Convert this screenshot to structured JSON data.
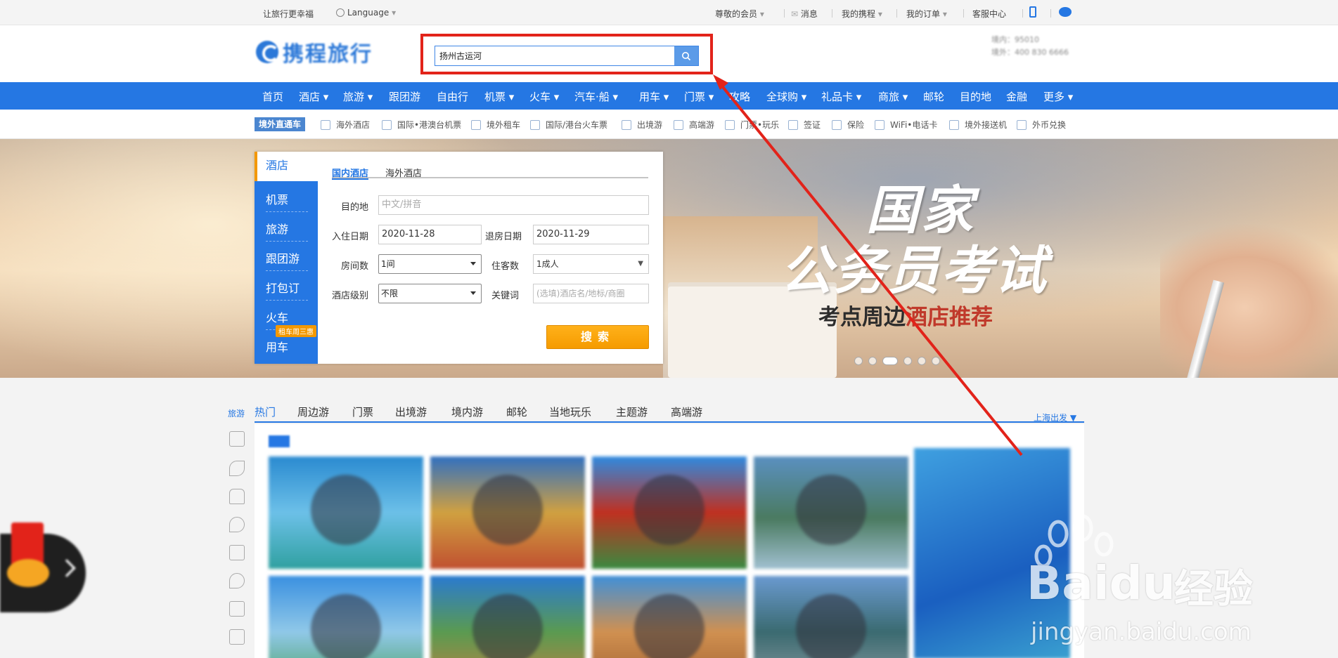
{
  "topbar": {
    "slogan": "让旅行更幸福",
    "language": "Language",
    "member": "尊敬的会员",
    "messages": "消息",
    "my_trips": "我的携程",
    "my_orders": "我的订单",
    "service": "客服中心"
  },
  "header": {
    "logo_text": "携程旅行",
    "search_value": "扬州古运河",
    "hotline_1": "境内：95010",
    "hotline_2": "境外：400 830 6666"
  },
  "nav": {
    "items": [
      "首页",
      "酒店 ▾",
      "旅游 ▾",
      "跟团游",
      "自由行",
      "机票 ▾",
      "火车 ▾",
      "汽车·船 ▾",
      "用车 ▾",
      "门票 ▾",
      "攻略",
      "全球购 ▾",
      "礼品卡 ▾",
      "商旅 ▾",
      "邮轮",
      "目的地",
      "金融",
      "更多 ▾"
    ]
  },
  "subnav": {
    "badge": "境外直通车",
    "items": [
      "海外酒店",
      "国际•港澳台机票",
      "境外租车",
      "国际/港台火车票",
      "出境游",
      "高端游",
      "门票•玩乐",
      "签证",
      "保险",
      "WiFi•电话卡",
      "境外接送机",
      "外币兑换"
    ]
  },
  "booking": {
    "side_tabs": [
      "酒店",
      "机票",
      "旅游",
      "跟团游",
      "打包订",
      "火车",
      "用车"
    ],
    "rent_badge": "租车周三惠",
    "tabs": [
      "国内酒店",
      "海外酒店"
    ],
    "dest_label": "目的地",
    "dest_placeholder": "中文/拼音",
    "checkin_label": "入住日期",
    "checkin_value": "2020-11-28",
    "checkout_label": "退房日期",
    "checkout_value": "2020-11-29",
    "rooms_label": "房间数",
    "rooms_value": "1间",
    "guests_label": "住客数",
    "guests_value": "1成人",
    "level_label": "酒店级别",
    "level_value": "不限",
    "keyword_label": "关键词",
    "keyword_placeholder": "(选填)酒店名/地标/商圈",
    "search_button": "搜索"
  },
  "banner": {
    "line1": "国家",
    "line2": "公务员考试",
    "line3_a": "考点周边",
    "line3_b": "酒店推荐"
  },
  "tours": {
    "side_label": "旅游",
    "tabs": [
      "热门",
      "周边游",
      "门票",
      "出境游",
      "境内游",
      "邮轮",
      "当地玩乐",
      "主题游",
      "高端游"
    ],
    "depart": "上海出发"
  },
  "watermark": {
    "brand": "Bai",
    "brand_du": "du",
    "jingyan": "经验",
    "url": "jingyan.baidu.com"
  },
  "colors": {
    "brand_blue": "#2577e3",
    "search_orange": "#f59b00",
    "annotation_red": "#e2231a"
  }
}
